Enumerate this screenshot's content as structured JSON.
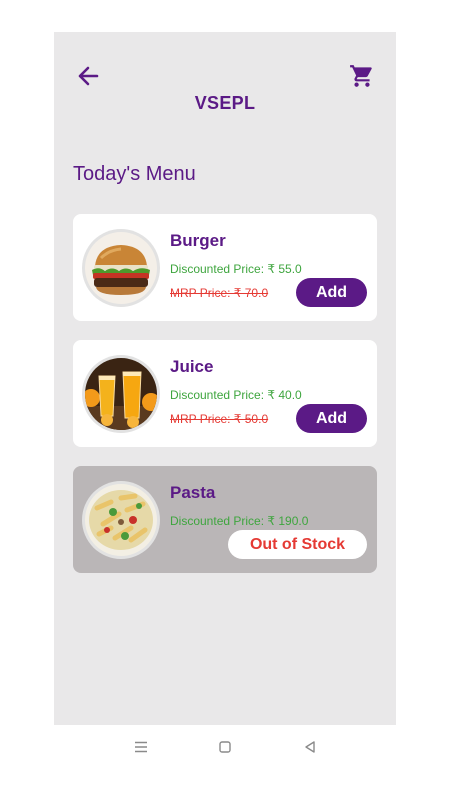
{
  "header": {
    "back_icon": "arrow-left-icon",
    "cart_icon": "shopping-cart-icon",
    "title": "VSEPL"
  },
  "section_title": "Today's Menu",
  "colors": {
    "brand": "#5b1a86",
    "discount_price": "#3ea53e",
    "mrp_price": "#e53a34",
    "screen_background": "#e9e8e9",
    "out_of_stock_card": "#bab6b7"
  },
  "menu_items": [
    {
      "name": "Burger",
      "discount_price": "Discounted Price: ₹ 55.0",
      "mrp_price": "MRP Price: ₹ 70.0",
      "action_label": "Add",
      "in_stock": true
    },
    {
      "name": "Juice",
      "discount_price": "Discounted Price: ₹ 40.0",
      "mrp_price": "MRP Price: ₹ 50.0",
      "action_label": "Add",
      "in_stock": true
    },
    {
      "name": "Pasta",
      "discount_price": "Discounted Price: ₹ 190.0",
      "action_label": "Out of Stock",
      "in_stock": false
    }
  ],
  "system_nav": {
    "menu_icon": "menu-lines-icon",
    "home_icon": "home-square-icon",
    "back_icon": "triangle-back-icon"
  }
}
